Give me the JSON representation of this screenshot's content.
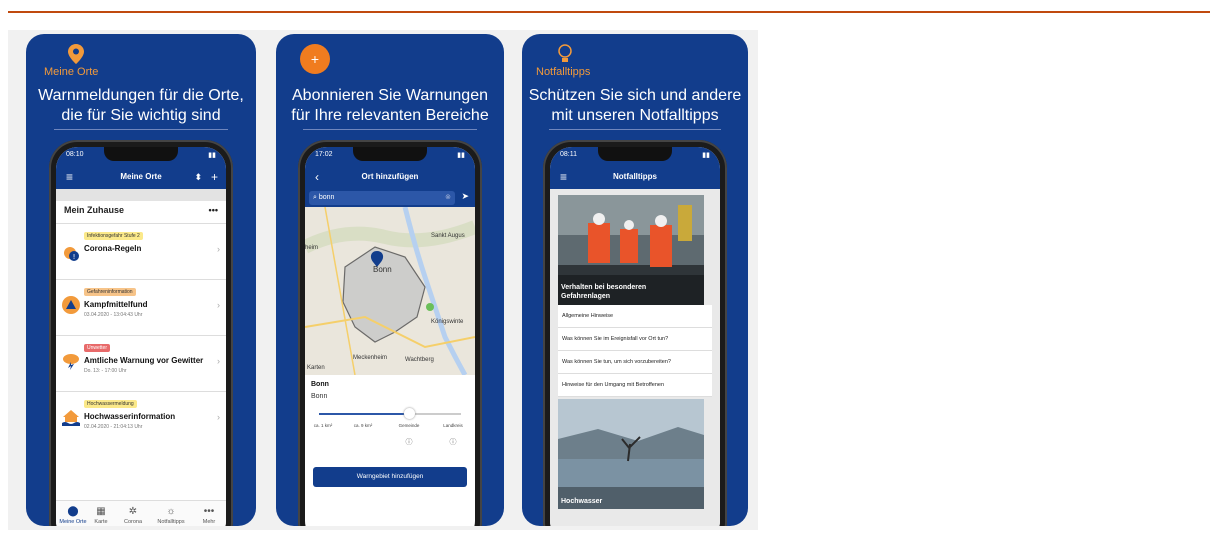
{
  "colors": {
    "brand_blue": "#123d8c",
    "accent_orange": "#f29a3b",
    "topline": "#c04a0e"
  },
  "cards": [
    {
      "tag": "Meine Orte",
      "headline_1": "Warnmeldungen für die Orte,",
      "headline_2": "die für Sie wichtig sind",
      "phone": {
        "time": "08:10",
        "nav_title": "Meine Orte",
        "section": "Mein Zuhause",
        "items": [
          {
            "badge": "Infektionsgefahr Stufe 2",
            "title": "Corona-Regeln",
            "subtitle": ""
          },
          {
            "badge": "Gefahreninformation",
            "title": "Kampfmittelfund",
            "subtitle": "03.04.2020 - 13:04:43 Uhr"
          },
          {
            "badge": "Unwetter",
            "title": "Amtliche Warnung vor Gewitter",
            "subtitle": "Do. 13: - 17:00 Uhr"
          },
          {
            "badge": "Hochwassermeldung",
            "title": "Hochwasserinformation",
            "subtitle": "02.04.2020 - 21:04:13 Uhr"
          }
        ],
        "tabs": [
          "Meine Orte",
          "Karte",
          "Corona",
          "Notfalltipps",
          "Mehr"
        ]
      }
    },
    {
      "plus_icon": "+",
      "headline_1": "Abonnieren Sie Warnungen",
      "headline_2": "für Ihre relevanten Bereiche",
      "phone": {
        "time": "17:02",
        "nav_title": "Ort hinzufügen",
        "search_value": "bonn",
        "map_labels": [
          "Bonn",
          "Sankt Augus",
          "Königswinte",
          "Meckenheim",
          "Wachtberg",
          "Karten",
          "heim"
        ],
        "place_title": "Bonn",
        "place_sub": "Bonn",
        "slider_stops": [
          "ca. 1 km²",
          "ca. 9 km²",
          "Gemeinde",
          "Landkreis"
        ],
        "add_button": "Warngebiet hinzufügen"
      }
    },
    {
      "tag": "Notfalltipps",
      "headline_1": "Schützen Sie sich und andere",
      "headline_2": "mit unseren Notfalltipps",
      "phone": {
        "time": "08:11",
        "nav_title": "Notfalltipps",
        "photo1_caption_1": "Verhalten bei besonderen",
        "photo1_caption_2": "Gefahrenlagen",
        "links": [
          "Allgemeine Hinweise",
          "Was können Sie im Ereignisfall vor Ort tun?",
          "Was können Sie tun, um sich vorzubereiten?",
          "Hinweise für den Umgang mit Betroffenen"
        ],
        "photo2_caption": "Hochwasser"
      }
    }
  ]
}
